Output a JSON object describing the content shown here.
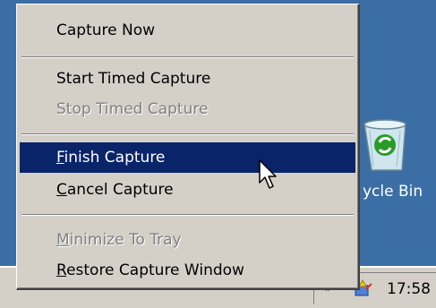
{
  "menu": {
    "items": [
      {
        "label": "Capture Now",
        "mnemonic": "",
        "rest": "Capture Now",
        "enabled": true
      },
      {
        "label": "Start Timed Capture",
        "mnemonic": "",
        "rest": "Start Timed Capture",
        "enabled": true
      },
      {
        "label": "Stop Timed Capture",
        "mnemonic": "",
        "rest": "Stop Timed Capture",
        "enabled": false
      },
      {
        "label": "Finish Capture",
        "mnemonic": "F",
        "rest": "inish Capture",
        "enabled": true,
        "highlighted": true
      },
      {
        "label": "Cancel Capture",
        "mnemonic": "C",
        "rest": "ancel Capture",
        "enabled": true
      },
      {
        "label": "Minimize To Tray",
        "mnemonic": "M",
        "rest": "inimize To Tray",
        "enabled": false
      },
      {
        "label": "Restore Capture Window",
        "mnemonic": "R",
        "rest": "estore Capture Window",
        "enabled": true
      }
    ]
  },
  "desktop": {
    "recycle_bin_label": "ycle Bin"
  },
  "taskbar": {
    "clock": "17:58",
    "tray_arrow": "«"
  },
  "colors": {
    "desktop": "#3a6ea5",
    "menu_bg": "#d4d0c8",
    "highlight": "#0a246a",
    "disabled_text": "#808080"
  },
  "icons": [
    "recycle-bin-icon",
    "tray-app-icon",
    "mouse-pointer-icon"
  ]
}
